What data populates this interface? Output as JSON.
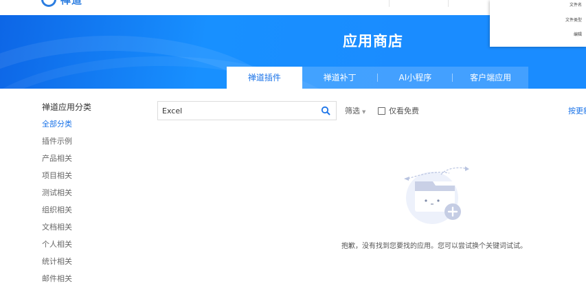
{
  "header": {
    "logo_text": "禅道",
    "accent_color": "#1a73e8",
    "banner_color": "#1890ff"
  },
  "banner": {
    "title": "应用商店",
    "tabs": [
      {
        "label": "禅道插件",
        "active": true
      },
      {
        "label": "禅道补丁",
        "active": false
      },
      {
        "label": "AI小程序",
        "active": false
      },
      {
        "label": "客户端应用",
        "active": false
      }
    ]
  },
  "thumbnail": {
    "lines": [
      "文件名",
      "文件类型",
      "编辑"
    ]
  },
  "sidebar": {
    "title": "禅道应用分类",
    "items": [
      {
        "label": "全部分类",
        "active": true
      },
      {
        "label": "插件示例"
      },
      {
        "label": "产品相关"
      },
      {
        "label": "项目相关"
      },
      {
        "label": "测试相关"
      },
      {
        "label": "组织相关"
      },
      {
        "label": "文档相关"
      },
      {
        "label": "个人相关"
      },
      {
        "label": "统计相关"
      },
      {
        "label": "邮件相关"
      }
    ]
  },
  "search": {
    "value": "Excel",
    "icon": "search-icon"
  },
  "toolbar": {
    "filter_label": "筛选",
    "free_only_label": "仅看免费",
    "free_only_checked": false,
    "sort_label": "按更新"
  },
  "empty_state": {
    "message": "抱歉，没有找到您要找的应用。您可以尝试换个关键词试试。"
  }
}
